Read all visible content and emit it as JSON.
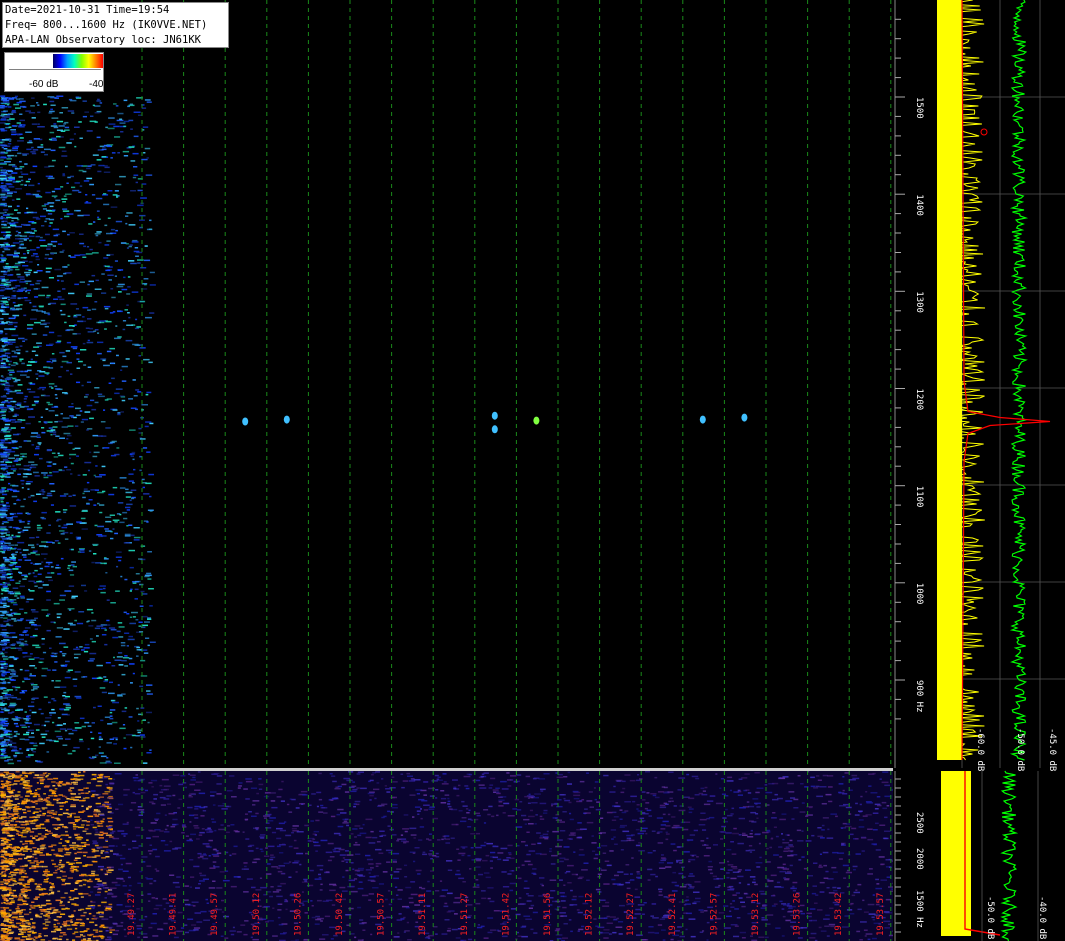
{
  "header": {
    "line1": "Date=2021-10-31 Time=19:54",
    "line2": "Freq= 800...1600 Hz (IK0VVE.NET)",
    "line3": "APA-LAN Observatory loc: JN61KK"
  },
  "colorbar": {
    "low_label": "-60 dB",
    "high_label": "-40"
  },
  "colors": {
    "background": "#000000",
    "grid_line": "#1a8a1a",
    "spectrum_max": "#ffff00",
    "spectrum_avg": "#00ff00",
    "spectrum_peak": "#ff0000",
    "time_label": "#ff2020",
    "axis_text": "#ffffff"
  },
  "chart_data": [
    {
      "type": "heatmap",
      "title": "",
      "ylabel": "Hz",
      "ylim": [
        800,
        1600
      ],
      "yticks": [
        "1500",
        "1400",
        "1300",
        "1200",
        "1100",
        "1000",
        "900 Hz"
      ],
      "y_values": [
        1500,
        1400,
        1300,
        1200,
        1100,
        1000,
        900
      ],
      "detections": [
        {
          "time": "19.49.57",
          "freq_hz": 1166
        },
        {
          "time": "19.50.12",
          "freq_hz": 1168
        },
        {
          "time": "19.51.27",
          "freq_hz": 1172
        },
        {
          "time": "19.51.27",
          "freq_hz": 1158
        },
        {
          "time": "19.51.42",
          "freq_hz": 1167
        },
        {
          "time": "19.52.41",
          "freq_hz": 1168
        },
        {
          "time": "19.52.57",
          "freq_hz": 1170
        }
      ],
      "side_spectrum": {
        "x_labels": [
          "-60.0 dB",
          "-50.0 dB",
          "-45.0 dB"
        ],
        "peak_freq_hz": 1166
      }
    },
    {
      "type": "heatmap",
      "title": "",
      "ylabel": "Hz",
      "yticks": [
        "2500",
        "2000",
        "1500 Hz"
      ],
      "x_tick_labels": [
        "19.49.27",
        "19.49.41",
        "19.49.57",
        "19.50.12",
        "19.50.26",
        "19.50.42",
        "19.50.57",
        "19.51.11",
        "19.51.27",
        "19.51.42",
        "19.51.56",
        "19.52.12",
        "19.52.27",
        "19.52.41",
        "19.52.57",
        "19.53.12",
        "19.53.26",
        "19.53.42",
        "19.53.57"
      ],
      "side_spectrum": {
        "x_labels": [
          "-50.0 dB",
          "-40.0 dB"
        ]
      }
    }
  ]
}
